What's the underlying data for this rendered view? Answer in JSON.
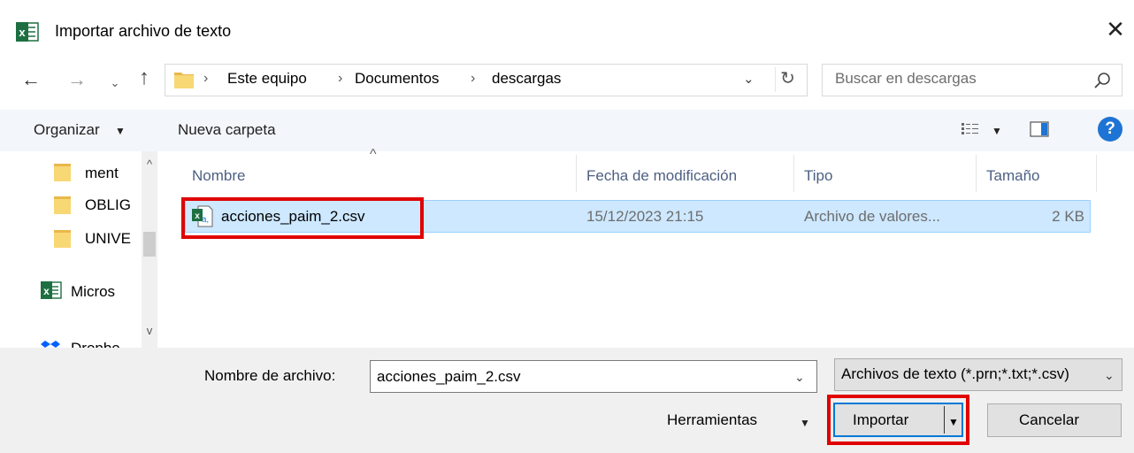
{
  "window": {
    "title": "Importar archivo de texto",
    "app_icon": "excel-icon",
    "close_glyph": "✕"
  },
  "nav": {
    "back_glyph": "←",
    "forward_glyph": "→",
    "recent_glyph": "⌄",
    "up_glyph": "↑"
  },
  "address": {
    "separator": "›",
    "crumbs": [
      "Este equipo",
      "Documentos",
      "descargas"
    ],
    "dropdown_glyph": "⌄",
    "refresh_glyph": "↻"
  },
  "search": {
    "placeholder": "Buscar en descargas"
  },
  "toolbar": {
    "organize": "Organizar",
    "organize_arrow": "▼",
    "new_folder": "Nueva carpeta",
    "view_arrow": "▼",
    "help": "?"
  },
  "navpane": {
    "items": [
      {
        "label": "ment",
        "icon": "folder-icon"
      },
      {
        "label": "OBLIG",
        "icon": "folder-icon"
      },
      {
        "label": "UNIVE",
        "icon": "folder-icon"
      },
      {
        "label": "Micros",
        "icon": "excel-icon"
      },
      {
        "label": "Dropbo",
        "icon": "dropbox-icon"
      }
    ],
    "scroll_up": "^",
    "scroll_down": "v"
  },
  "filelist": {
    "sort_caret": "^",
    "columns": [
      "Nombre",
      "Fecha de modificación",
      "Tipo",
      "Tamaño"
    ],
    "rows": [
      {
        "name": "acciones_paim_2.csv",
        "modified": "15/12/2023 21:15",
        "type": "Archivo de valores...",
        "size": "2 KB",
        "selected": true
      }
    ]
  },
  "bottom": {
    "filename_label": "Nombre de archivo:",
    "filename_value": "acciones_paim_2.csv",
    "filename_dropdown": "⌄",
    "filter_value": "Archivos de texto (*.prn;*.txt;*.csv)",
    "filter_dropdown": "⌄",
    "tools_label": "Herramientas",
    "tools_arrow": "▼",
    "import_label": "Importar",
    "import_arrow": "▼",
    "cancel_label": "Cancelar"
  },
  "colors": {
    "selection_bg": "#cde8ff",
    "selection_border": "#99d1ff",
    "highlight_red": "#e00000",
    "accent_blue": "#0078d7",
    "excel_green": "#1d6f42",
    "folder_yellow": "#f8d775"
  }
}
